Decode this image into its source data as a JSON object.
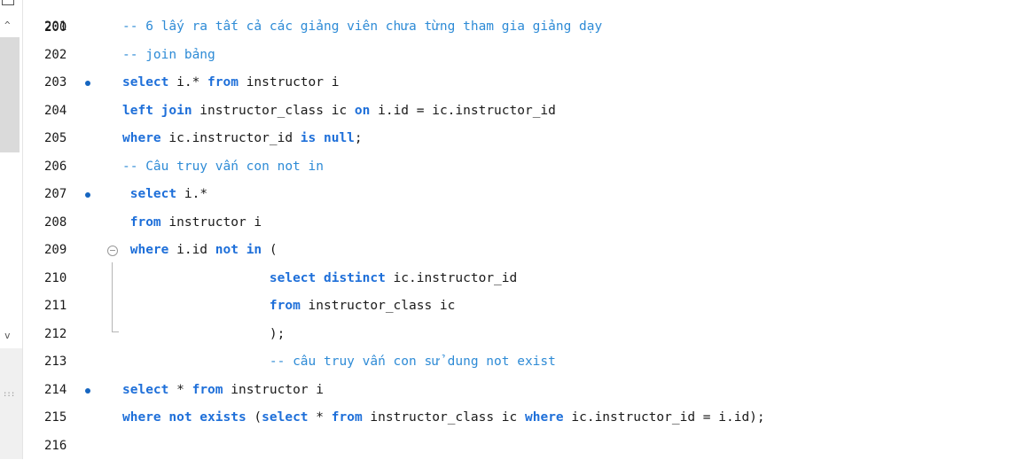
{
  "colors": {
    "keyword": "#1e6fd9",
    "comment": "#2e8bd6",
    "text": "#1a1a1a",
    "breakpoint": "#1565c0"
  },
  "gutter": {
    "top_partial": "200",
    "scroll_up_icon": "^",
    "scroll_down_icon": "v",
    "grip_icon": ":::"
  },
  "lines": [
    {
      "num": "201",
      "bp": false,
      "segments": [
        {
          "t": "cm",
          "v": "-- 6 lấy ra tất cả các giảng viên chưa từng tham gia giảng dạy"
        }
      ]
    },
    {
      "num": "202",
      "bp": false,
      "segments": [
        {
          "t": "cm",
          "v": "-- join bảng"
        }
      ]
    },
    {
      "num": "203",
      "bp": true,
      "segments": [
        {
          "t": "kw",
          "v": "select"
        },
        {
          "t": "tx",
          "v": " i.* "
        },
        {
          "t": "kw",
          "v": "from"
        },
        {
          "t": "tx",
          "v": " instructor i"
        }
      ]
    },
    {
      "num": "204",
      "bp": false,
      "segments": [
        {
          "t": "kw",
          "v": "left join"
        },
        {
          "t": "tx",
          "v": " instructor_class ic "
        },
        {
          "t": "kw",
          "v": "on"
        },
        {
          "t": "tx",
          "v": " i.id = ic.instructor_id"
        }
      ]
    },
    {
      "num": "205",
      "bp": false,
      "segments": [
        {
          "t": "kw",
          "v": "where"
        },
        {
          "t": "tx",
          "v": " ic.instructor_id "
        },
        {
          "t": "kw",
          "v": "is null"
        },
        {
          "t": "tx",
          "v": ";"
        }
      ]
    },
    {
      "num": "206",
      "bp": false,
      "segments": [
        {
          "t": "cm",
          "v": "-- Câu truy vấn con not in"
        }
      ]
    },
    {
      "num": "207",
      "bp": true,
      "segments": [
        {
          "t": "tx",
          "v": " "
        },
        {
          "t": "kw",
          "v": "select"
        },
        {
          "t": "tx",
          "v": " i.*"
        }
      ]
    },
    {
      "num": "208",
      "bp": false,
      "segments": [
        {
          "t": "tx",
          "v": " "
        },
        {
          "t": "kw",
          "v": "from"
        },
        {
          "t": "tx",
          "v": " instructor i"
        }
      ]
    },
    {
      "num": "209",
      "bp": false,
      "fold": true,
      "segments": [
        {
          "t": "tx",
          "v": " "
        },
        {
          "t": "kw",
          "v": "where"
        },
        {
          "t": "tx",
          "v": " i.id "
        },
        {
          "t": "kw",
          "v": "not in"
        },
        {
          "t": "tx",
          "v": " ("
        }
      ]
    },
    {
      "num": "210",
      "bp": false,
      "segments": [
        {
          "t": "tx",
          "v": "                   "
        },
        {
          "t": "kw",
          "v": "select distinct"
        },
        {
          "t": "tx",
          "v": " ic.instructor_id"
        }
      ]
    },
    {
      "num": "211",
      "bp": false,
      "segments": [
        {
          "t": "tx",
          "v": "                   "
        },
        {
          "t": "kw",
          "v": "from"
        },
        {
          "t": "tx",
          "v": " instructor_class ic"
        }
      ]
    },
    {
      "num": "212",
      "bp": false,
      "segments": [
        {
          "t": "tx",
          "v": "                   );"
        }
      ]
    },
    {
      "num": "213",
      "bp": false,
      "segments": [
        {
          "t": "tx",
          "v": "                   "
        },
        {
          "t": "cm",
          "v": "-- câu truy vấn con sử dung not exist"
        }
      ]
    },
    {
      "num": "214",
      "bp": true,
      "segments": [
        {
          "t": "kw",
          "v": "select"
        },
        {
          "t": "tx",
          "v": " * "
        },
        {
          "t": "kw",
          "v": "from"
        },
        {
          "t": "tx",
          "v": " instructor i"
        }
      ]
    },
    {
      "num": "215",
      "bp": false,
      "segments": [
        {
          "t": "kw",
          "v": "where not exists"
        },
        {
          "t": "tx",
          "v": " ("
        },
        {
          "t": "kw",
          "v": "select"
        },
        {
          "t": "tx",
          "v": " * "
        },
        {
          "t": "kw",
          "v": "from"
        },
        {
          "t": "tx",
          "v": " instructor_class ic "
        },
        {
          "t": "kw",
          "v": "where"
        },
        {
          "t": "tx",
          "v": " ic.instructor_id = i.id);"
        }
      ]
    },
    {
      "num": "216",
      "bp": false,
      "segments": []
    }
  ]
}
